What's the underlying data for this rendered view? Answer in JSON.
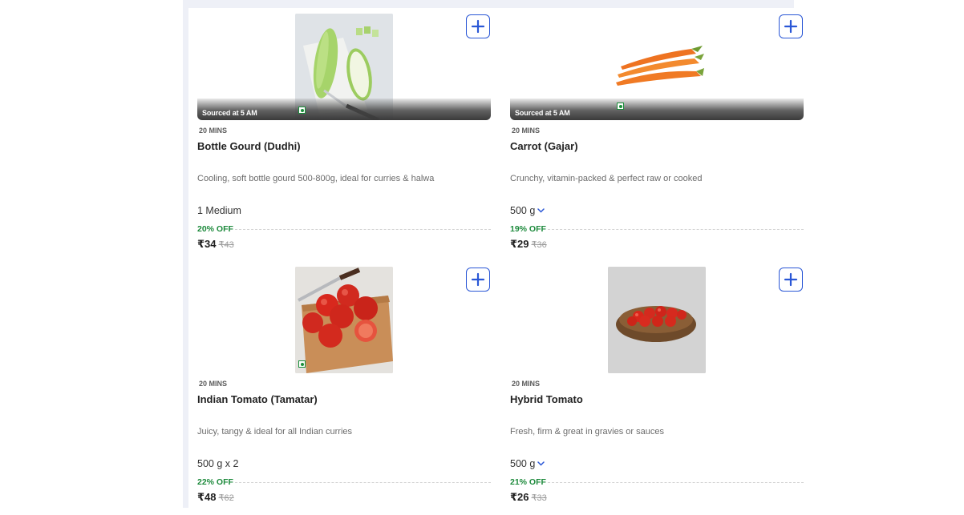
{
  "colors": {
    "accent": "#2a57d6",
    "discount": "#1d8a3c",
    "veg_mark": "#1a8f3a"
  },
  "products": [
    {
      "name": "Bottle Gourd (Dudhi)",
      "eta": "20 MINS",
      "badge": "Sourced at 5 AM",
      "description": "Cooling, soft bottle gourd 500-800g, ideal for curries & halwa",
      "quantity": "1 Medium",
      "quantity_dropdown": false,
      "discount": "20% OFF",
      "price": "₹34",
      "mrp": "₹43",
      "image_icon": "bottle-gourd-image"
    },
    {
      "name": "Carrot (Gajar)",
      "eta": "20 MINS",
      "badge": "Sourced at 5 AM",
      "description": "Crunchy, vitamin-packed & perfect raw or cooked",
      "quantity": "500 g",
      "quantity_dropdown": true,
      "discount": "19% OFF",
      "price": "₹29",
      "mrp": "₹36",
      "image_icon": "carrot-image"
    },
    {
      "name": "Indian Tomato (Tamatar)",
      "eta": "20 MINS",
      "badge": "",
      "description": "Juicy, tangy & ideal for all Indian curries",
      "quantity": "500 g x 2",
      "quantity_dropdown": false,
      "discount": "22% OFF",
      "price": "₹48",
      "mrp": "₹62",
      "image_icon": "tomato-image"
    },
    {
      "name": "Hybrid Tomato",
      "eta": "20 MINS",
      "badge": "",
      "description": "Fresh, firm & great in gravies or sauces",
      "quantity": "500 g",
      "quantity_dropdown": true,
      "discount": "21% OFF",
      "price": "₹26",
      "mrp": "₹33",
      "image_icon": "tomato-bowl-image"
    }
  ]
}
